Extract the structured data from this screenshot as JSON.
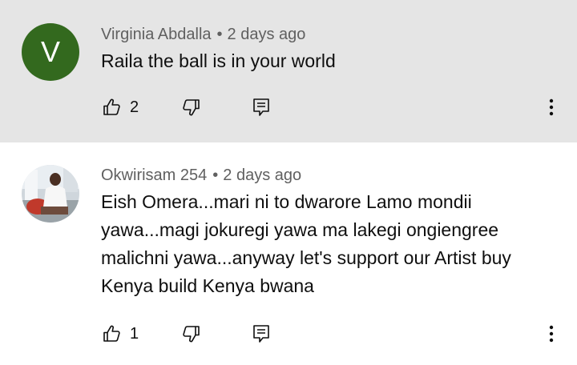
{
  "comments": [
    {
      "avatar_letter": "V",
      "avatar_color": "#33691e",
      "author": "Virginia Abdalla",
      "separator": "•",
      "time": "2 days ago",
      "text": "Raila the ball is in your world",
      "likes": "2",
      "background": "#e5e5e5"
    },
    {
      "avatar_image": "photo of person",
      "author": "Okwirisam 254",
      "separator": "•",
      "time": "2 days ago",
      "text": "Eish Omera...mari ni to dwarore Lamo mondii yawa...magi jokuregi yawa ma lakegi ongiengree malichni yawa...anyway let's support our Artist buy Kenya build Kenya bwana",
      "likes": "1",
      "background": "#ffffff"
    }
  ],
  "icons": {
    "like": "thumbs-up-icon",
    "dislike": "thumbs-down-icon",
    "reply": "reply-comment-icon",
    "more": "more-vertical-icon"
  }
}
